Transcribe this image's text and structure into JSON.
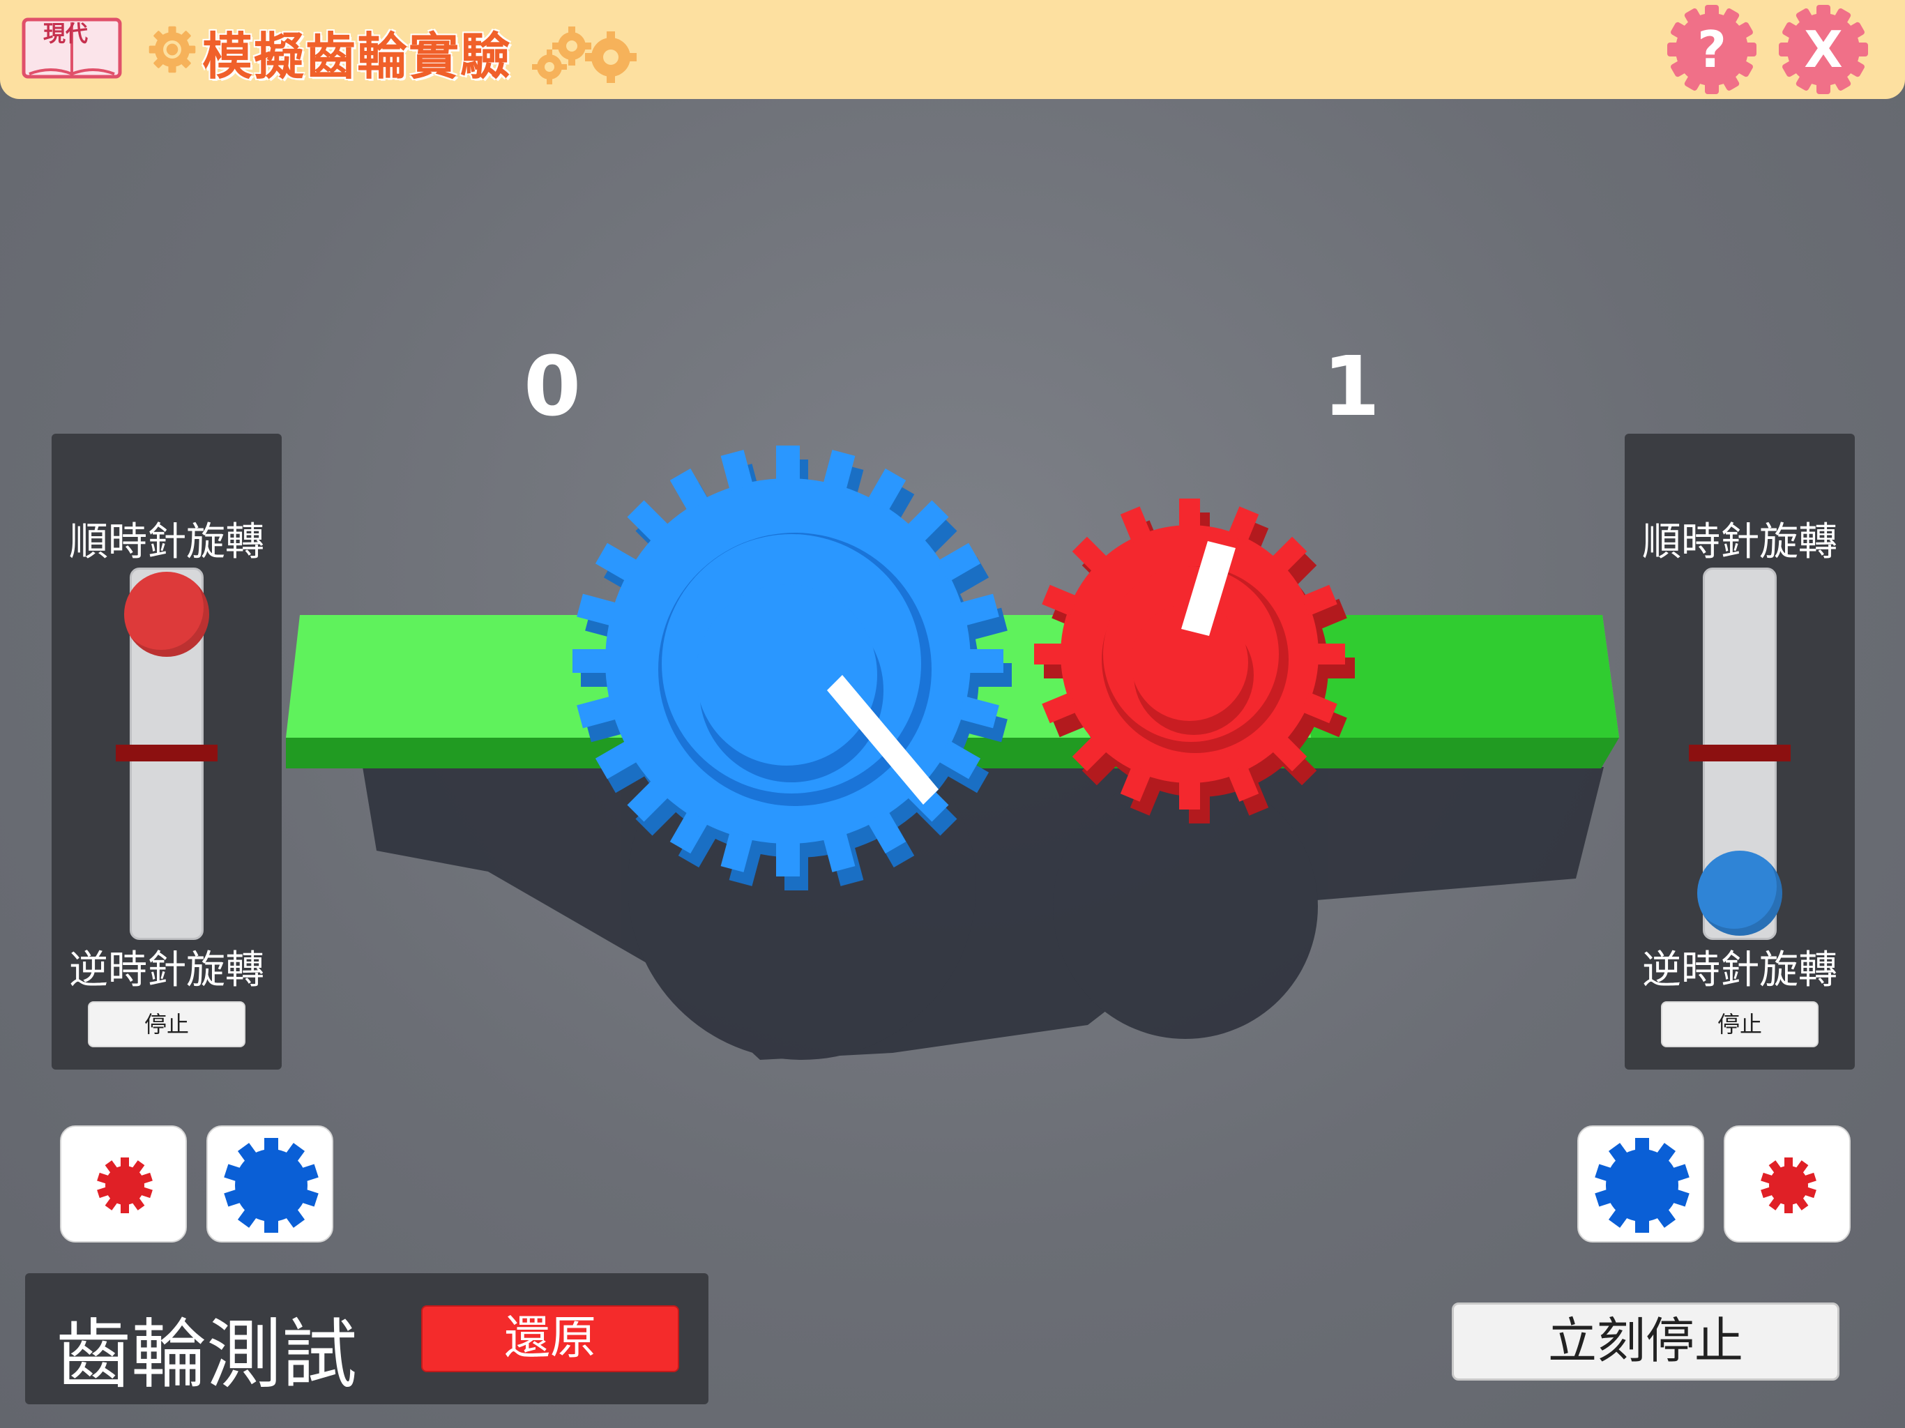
{
  "header": {
    "logo_text": "現代",
    "title": "模擬齒輪實驗",
    "help_label": "?",
    "close_label": "X"
  },
  "counters": {
    "left": "0",
    "right": "1"
  },
  "left_panel": {
    "clockwise_label": "順時針旋轉",
    "counterclockwise_label": "逆時針旋轉",
    "stop_label": "停止",
    "knob_state": "clockwise",
    "knob_color": "#dd3a3a"
  },
  "right_panel": {
    "clockwise_label": "順時針旋轉",
    "counterclockwise_label": "逆時針旋轉",
    "stop_label": "停止",
    "knob_state": "counterclockwise",
    "knob_color": "#2f84d6"
  },
  "gear_buttons": {
    "left": [
      "small-red-gear",
      "large-blue-gear"
    ],
    "right": [
      "large-blue-gear",
      "small-red-gear"
    ]
  },
  "test": {
    "label": "齒輪測試",
    "reset_label": "還原"
  },
  "stop_now_label": "立刻停止",
  "colors": {
    "header_bg": "#fde0a0",
    "title": "#f0602a",
    "header_buttons": "#f07088",
    "blue_gear": "#2a97ff",
    "red_gear": "#f4282e",
    "rail": "#5ff25c",
    "reset": "#f42b2b"
  }
}
